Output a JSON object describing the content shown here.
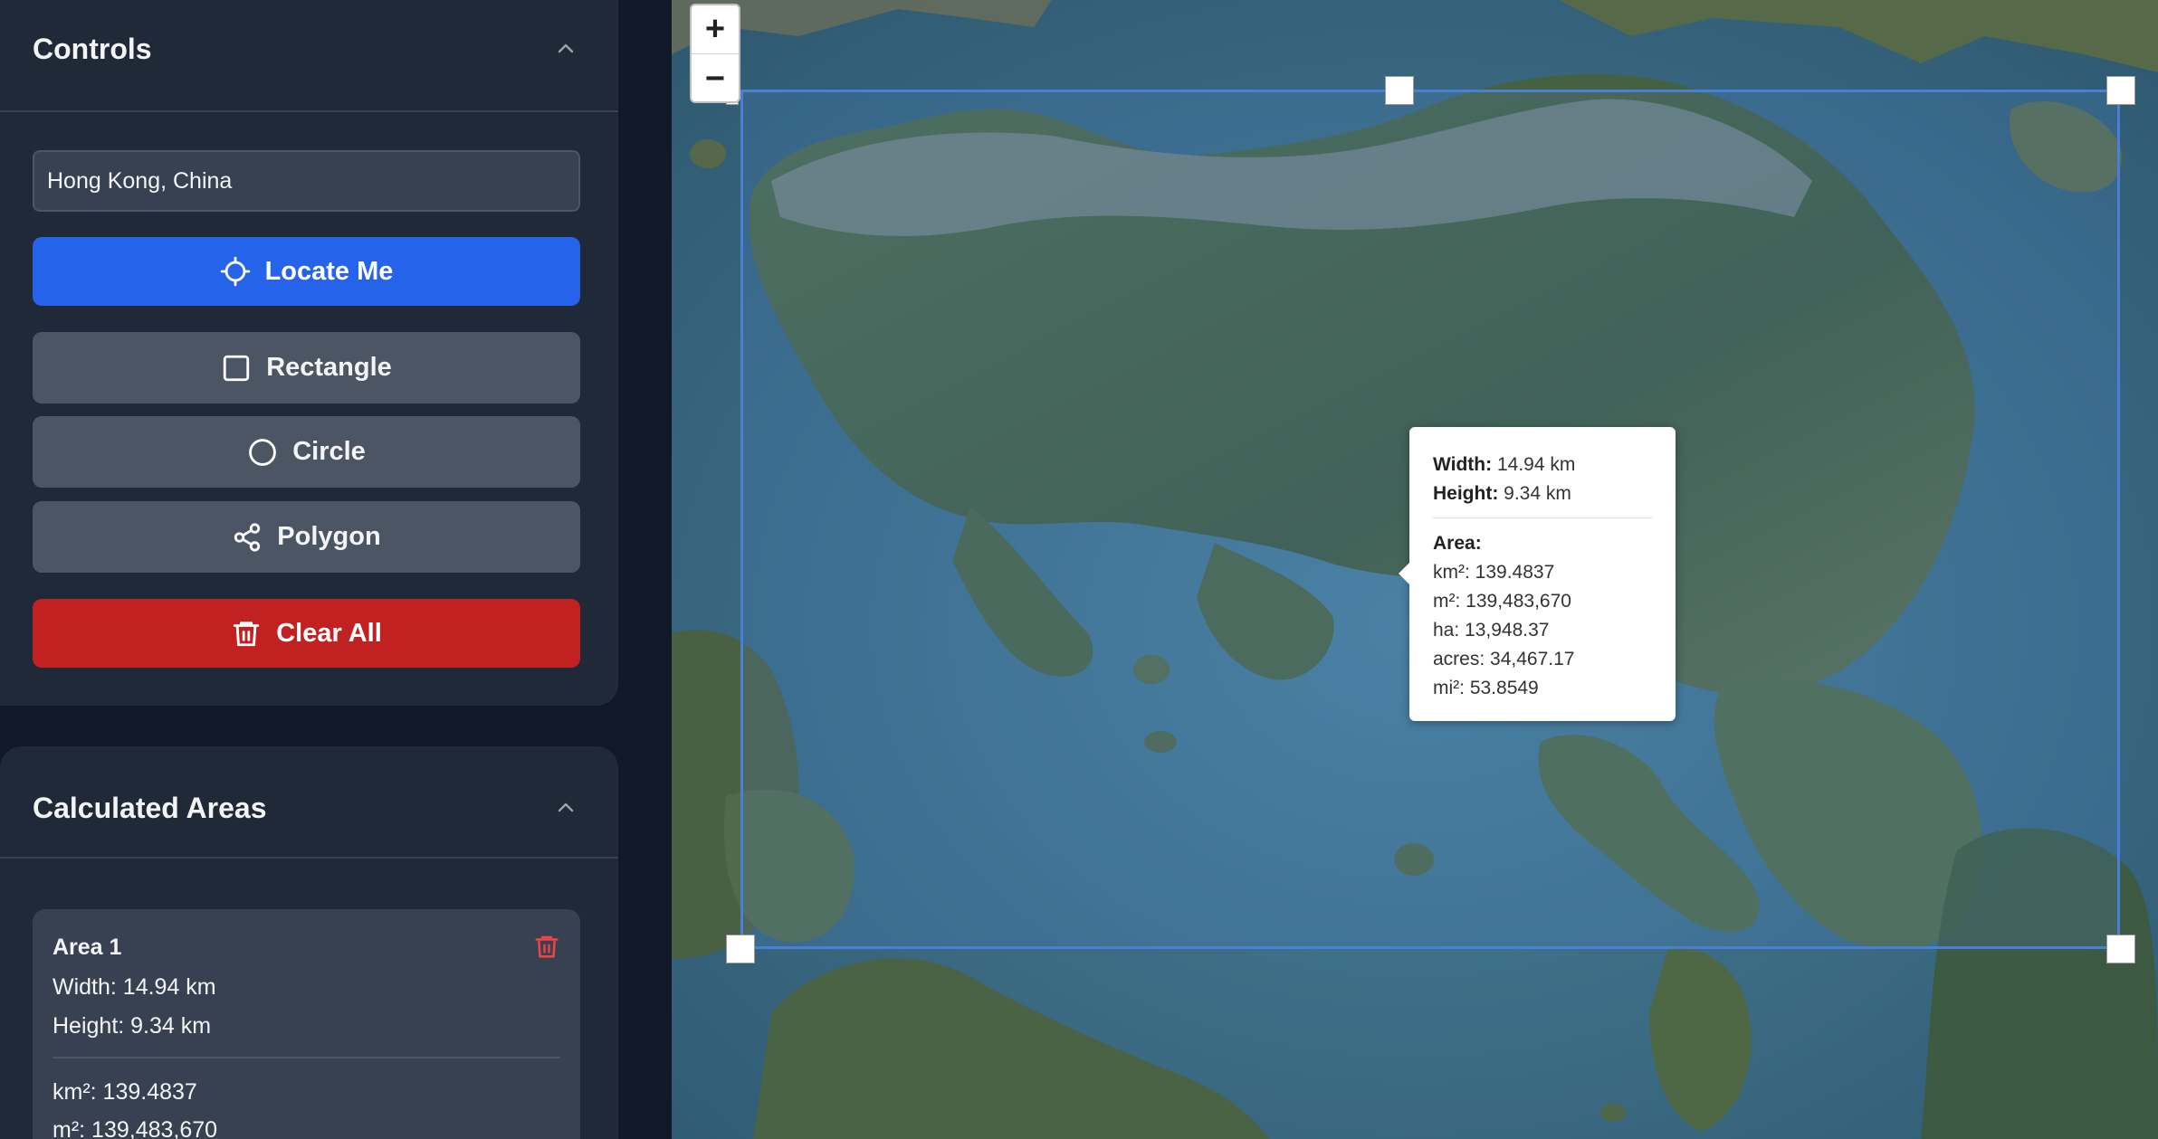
{
  "controls": {
    "title": "Controls",
    "location_value": "Hong Kong, China",
    "locate_label": "Locate Me",
    "rectangle_label": "Rectangle",
    "circle_label": "Circle",
    "polygon_label": "Polygon",
    "clear_label": "Clear All"
  },
  "areas_panel": {
    "title": "Calculated Areas",
    "items": [
      {
        "name": "Area 1",
        "width": "Width: 14.94 km",
        "height": "Height: 9.34 km",
        "km2": "km²: 139.4837",
        "m2": "m²: 139,483,670"
      }
    ]
  },
  "map": {
    "zoom_in": "+",
    "zoom_out": "−",
    "tooltip": {
      "width_label": "Width:",
      "width_value": " 14.94 km",
      "height_label": "Height:",
      "height_value": " 9.34 km",
      "area_label": "Area:",
      "km2": "km²: 139.4837",
      "m2": "m²: 139,483,670",
      "ha": "ha: 13,948.37",
      "acres": "acres: 34,467.17",
      "mi2": "mi²: 53.8549"
    }
  },
  "colors": {
    "primary": "#2563eb",
    "danger": "#c22121",
    "panel": "#1f2937",
    "selection": "#4a80d4"
  },
  "icons": [
    "chevron-up-icon",
    "crosshair-icon",
    "square-icon",
    "circle-icon",
    "share-nodes-icon",
    "trash-icon"
  ]
}
